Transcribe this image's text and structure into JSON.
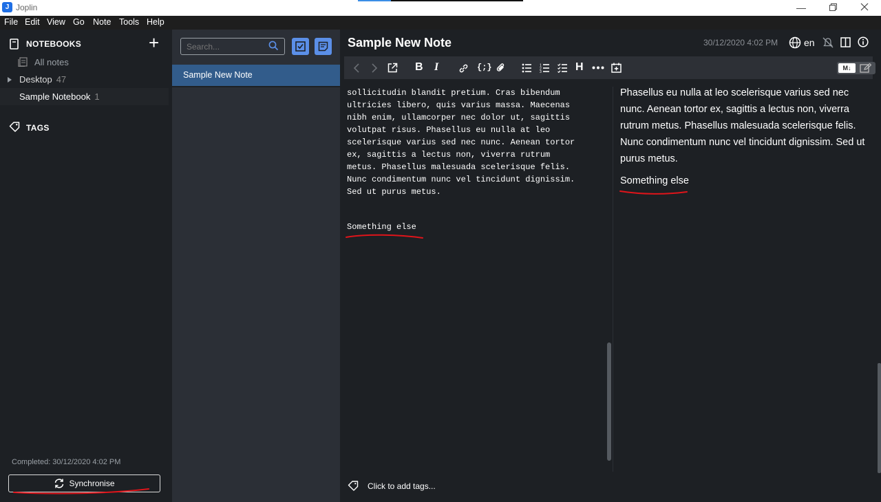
{
  "window": {
    "title": "Joplin",
    "app_icon_letter": "J"
  },
  "menu": [
    "File",
    "Edit",
    "View",
    "Go",
    "Note",
    "Tools",
    "Help"
  ],
  "sidebar": {
    "notebooks_header": "NOTEBOOKS",
    "add_label": "+",
    "all_notes": "All notes",
    "notebooks": [
      {
        "name": "Desktop",
        "count": "47"
      },
      {
        "name": "Sample Notebook",
        "count": "1"
      }
    ],
    "tags_header": "TAGS",
    "sync_status": "Completed: 30/12/2020 4:02 PM",
    "sync_button": "Synchronise"
  },
  "notelist": {
    "search_placeholder": "Search...",
    "notes": [
      {
        "title": "Sample New Note"
      }
    ]
  },
  "editor": {
    "title": "Sample New Note",
    "date": "30/12/2020 4:02 PM",
    "language": "en",
    "md_toggle_label": "M↓",
    "markdown_text": "sollicitudin blandit pretium. Cras bibendum\nultricies libero, quis varius massa. Maecenas\nnibh enim, ullamcorper nec dolor ut, sagittis\nvolutpat risus. Phasellus eu nulla at leo\nscelerisque varius sed nec nunc. Aenean tortor\nex, sagittis a lectus non, viverra rutrum\nmetus. Phasellus malesuada scelerisque felis.\nNunc condimentum nunc vel tincidunt dignissim.\nSed ut purus metus.",
    "markdown_extra": "Something else",
    "viewer_text": "Phasellus eu nulla at leo scelerisque varius sed nec nunc. Aenean tortor ex, sagittis a lectus non, viverra rutrum metus. Phasellus malesuada scelerisque felis. Nunc condimentum nunc vel tincidunt dignissim. Sed ut purus metus.",
    "viewer_extra": "Something else",
    "tags_prompt": "Click to add tags..."
  },
  "colors": {
    "sidebar_bg": "#1d2024",
    "notelist_bg": "#2b2f36",
    "selected_note": "#325c8b",
    "accent_button": "#5b8fe8",
    "annotation_red": "#e0141a"
  }
}
